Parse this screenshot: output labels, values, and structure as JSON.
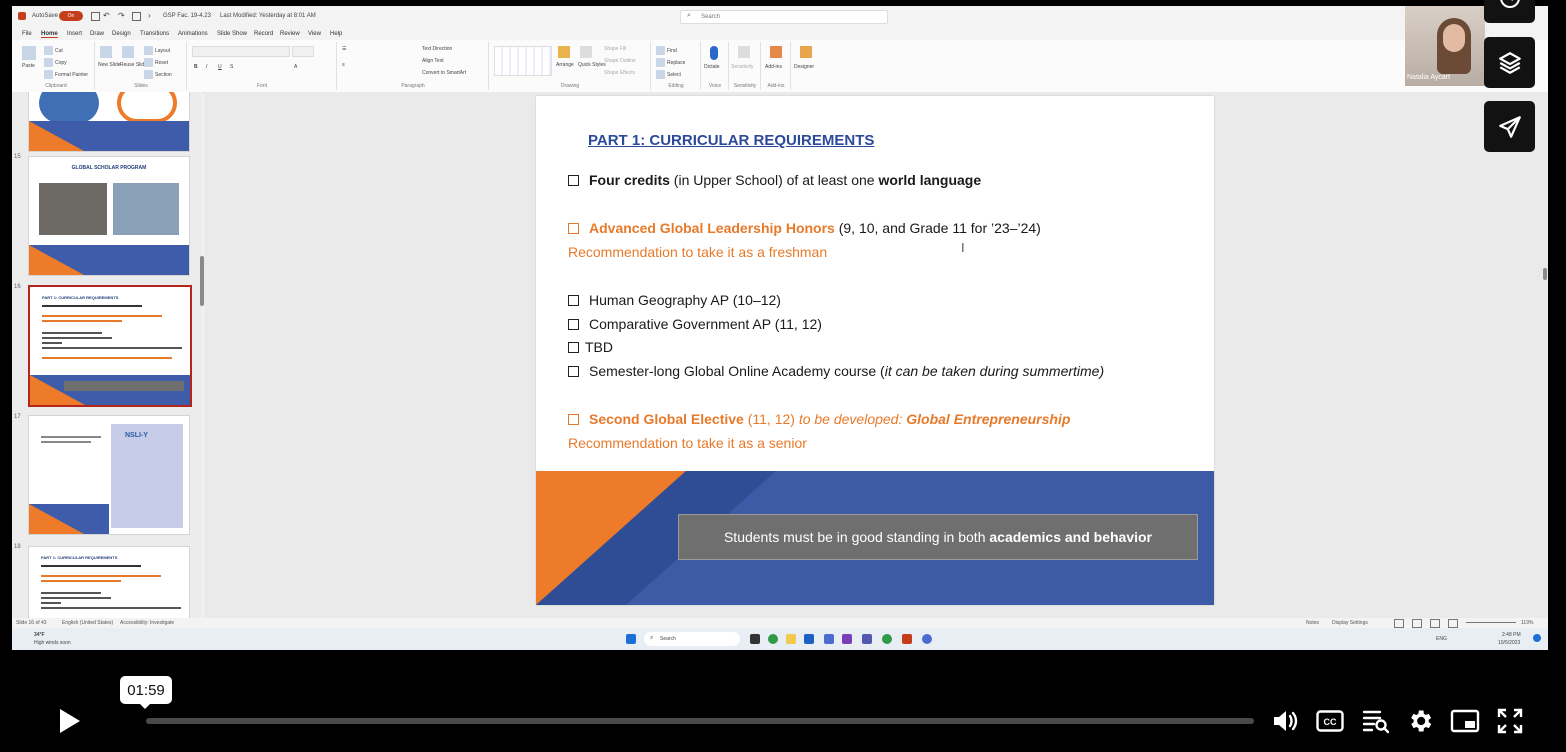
{
  "titlebar": {
    "autosave_label": "AutoSave",
    "autosave_state": "On",
    "file_title": "GSP Fac. 19-4.23",
    "last_modified": "Last Modified: Yesterday at 8:01 AM",
    "search_placeholder": "Search"
  },
  "ribbon_tabs": [
    "File",
    "Home",
    "Insert",
    "Draw",
    "Design",
    "Transitions",
    "Animations",
    "Slide Show",
    "Record",
    "Review",
    "View",
    "Help"
  ],
  "ribbon": {
    "clipboard": {
      "paste": "Paste",
      "cut": "Cut",
      "copy": "Copy",
      "format_painter": "Format Painter",
      "label": "Clipboard"
    },
    "slides": {
      "new_slide": "New Slide",
      "reuse_slides": "Reuse Slides",
      "layout": "Layout",
      "reset": "Reset",
      "section": "Section",
      "label": "Slides"
    },
    "font": {
      "label": "Font"
    },
    "paragraph": {
      "text_direction": "Text Direction",
      "align_text": "Align Text",
      "convert_smartart": "Convert to SmartArt",
      "label": "Paragraph"
    },
    "drawing": {
      "arrange": "Arrange",
      "quick_styles": "Quick Styles",
      "shape_fill": "Shape Fill",
      "shape_outline": "Shape Outline",
      "shape_effects": "Shape Effects",
      "label": "Drawing"
    },
    "editing": {
      "find": "Find",
      "replace": "Replace",
      "select": "Select",
      "label": "Editing"
    },
    "voice": {
      "dictate": "Dictate",
      "label": "Voice"
    },
    "sensitivity": {
      "sensitivity": "Sensitivity",
      "label": "Sensitivity"
    },
    "addins": {
      "addins": "Add-ins",
      "label": "Add-ins"
    },
    "designer": {
      "designer": "Designer"
    }
  },
  "thumbnails": [
    {
      "num": "15",
      "title": "GLOBAL SCHOLAR PROGRAM"
    },
    {
      "num": "16",
      "title": "PART 1: CURRICULAR REQUIREMENTS"
    },
    {
      "num": "17",
      "title": "NSLI-Y"
    },
    {
      "num": "18",
      "title": "PART 1: CURRICULAR REQUIREMENTS"
    }
  ],
  "slide": {
    "title": "PART 1: CURRICULAR REQUIREMENTS",
    "item1_bold": "Four credits",
    "item1_mid": " (in Upper School) of at least one ",
    "item1_bold2": "world language",
    "item2_bold": "Advanced Global Leadership Honors",
    "item2_rest": " (9, 10, and Grade 11 for ’23–’24)",
    "item2_note": "Recommendation to take it as a freshman",
    "list": [
      "Human Geography AP (10–12)",
      "Comparative Government AP (11, 12)",
      "TBD"
    ],
    "item_online_main": "Semester-long Global Online Academy course (",
    "item_online_italic": "it can be taken during  summertime)",
    "item3_bold": "Second Global Elective",
    "item3_mid": " (11, 12) ",
    "item3_italic": "to be developed: ",
    "item3_bolditalic": "Global Entrepreneurship",
    "item3_note": "Recommendation to take it as a senior",
    "standing_pre": "Students must be in good standing in both ",
    "standing_bold": "academics and behavior"
  },
  "statusbar": {
    "slide_of": "Slide 16 of 43",
    "language": "English (United States)",
    "accessibility": "Accessibility: Investigate",
    "notes": "Notes",
    "display_settings": "Display Settings",
    "zoom": "119%"
  },
  "taskbar": {
    "weather_temp": "34°F",
    "weather_desc": "High winds soon",
    "search": "Search",
    "lang": "ENG",
    "time": "2:48 PM",
    "date": "10/5/2023"
  },
  "webcam": {
    "name": "Natalia Aycart"
  },
  "player": {
    "time": "01:59",
    "progress_fraction": 0.0
  }
}
